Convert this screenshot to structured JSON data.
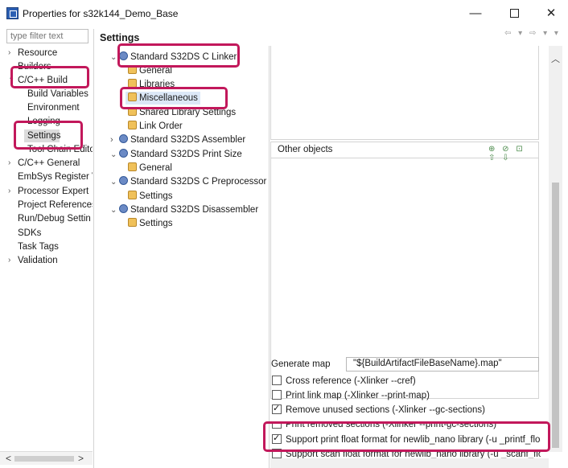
{
  "window": {
    "title": "Properties for s32k144_Demo_Base",
    "minimize": "—",
    "close": "✕"
  },
  "nav": {
    "filter_placeholder": "type filter text",
    "items": [
      {
        "label": "Resource",
        "chev": "›"
      },
      {
        "label": "Builders",
        "chev": ""
      },
      {
        "label": "C/C++ Build",
        "chev": "⌄"
      },
      {
        "label": "Build Variables",
        "chev": ""
      },
      {
        "label": "Environment",
        "chev": ""
      },
      {
        "label": "Logging",
        "chev": ""
      },
      {
        "label": "Settings",
        "chev": ""
      },
      {
        "label": "Tool Chain Edito",
        "chev": ""
      },
      {
        "label": "C/C++ General",
        "chev": "›"
      },
      {
        "label": "EmbSys Register V",
        "chev": ""
      },
      {
        "label": "Processor Expert",
        "chev": "›"
      },
      {
        "label": "Project References",
        "chev": ""
      },
      {
        "label": "Run/Debug Settin",
        "chev": ""
      },
      {
        "label": "SDKs",
        "chev": ""
      },
      {
        "label": "Task Tags",
        "chev": ""
      },
      {
        "label": "Validation",
        "chev": "›"
      }
    ],
    "scroll_left": "<",
    "scroll_right": ">"
  },
  "settings": {
    "title": "Settings",
    "header_nav": "⇦ ▾ ⇨ ▾ ▾"
  },
  "tree": {
    "items": [
      {
        "label": "Standard S32DS C Linker",
        "chev": "⌄"
      },
      {
        "label": "General",
        "chev": ""
      },
      {
        "label": "Libraries",
        "chev": ""
      },
      {
        "label": "Miscellaneous",
        "chev": ""
      },
      {
        "label": "Shared Library Settings",
        "chev": ""
      },
      {
        "label": "Link Order",
        "chev": ""
      },
      {
        "label": "Standard S32DS Assembler",
        "chev": "›"
      },
      {
        "label": "Standard S32DS Print Size",
        "chev": "⌄"
      },
      {
        "label": "General",
        "chev": ""
      },
      {
        "label": "Standard S32DS C Preprocessor",
        "chev": "⌄"
      },
      {
        "label": "Settings",
        "chev": ""
      },
      {
        "label": "Standard S32DS Disassembler",
        "chev": "⌄"
      },
      {
        "label": "Settings",
        "chev": ""
      }
    ]
  },
  "panel": {
    "other_objects_label": "Other objects",
    "other_tools": "⊕ ⊘ ⊡ ⇧ ⇩",
    "generate_map_label": "Generate map",
    "generate_map_value": "\"${BuildArtifactFileBaseName}.map\"",
    "checkboxes": [
      {
        "label": "Cross reference (-Xlinker --cref)",
        "checked": false
      },
      {
        "label": "Print link map (-Xlinker --print-map)",
        "checked": false
      },
      {
        "label": "Remove unused sections (-Xlinker --gc-sections)",
        "checked": true
      },
      {
        "label": "Print removed sections (-Xlinker --print-gc-sections)",
        "checked": false
      },
      {
        "label": "Support print float format for newlib_nano library (-u _printf_float",
        "checked": true
      },
      {
        "label": "Support scan float format for newlib_nano library (-u _scanf_float",
        "checked": false
      }
    ],
    "scroll_up": "︿"
  },
  "colors": {
    "highlight": "#c2185b",
    "selection": "#dce8f7",
    "nav_selection": "#dcdcdc"
  }
}
